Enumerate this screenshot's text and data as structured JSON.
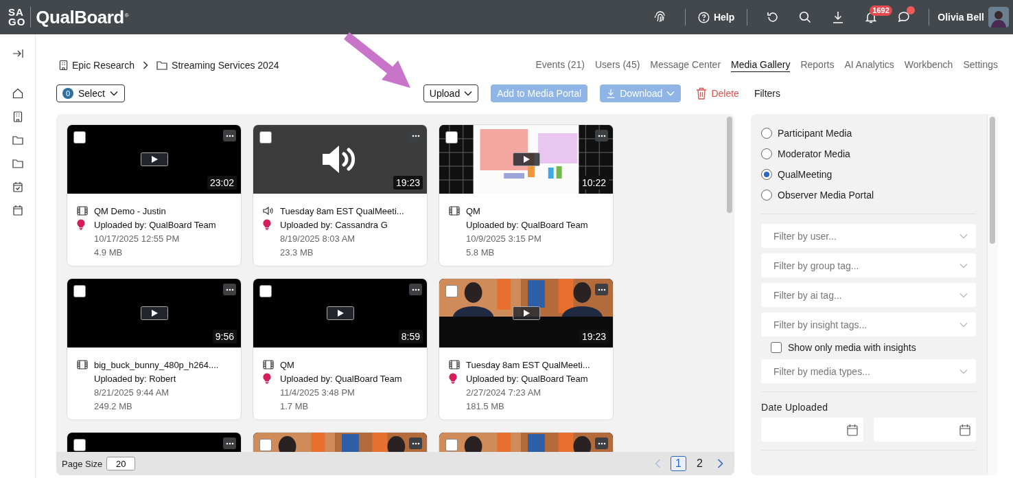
{
  "header": {
    "logo_mark": [
      "SA",
      "GO"
    ],
    "product": "QualBoard",
    "registered": "®",
    "help": "Help",
    "notifications": "1692",
    "user": "Olivia Bell"
  },
  "breadcrumb": [
    {
      "kind": "company",
      "label": "Epic Research"
    },
    {
      "kind": "folder",
      "label": "Streaming Services 2024"
    }
  ],
  "tabs": [
    {
      "label": "Events (21)",
      "selected": false
    },
    {
      "label": "Users (45)",
      "selected": false
    },
    {
      "label": "Message Center",
      "selected": false
    },
    {
      "label": "Media Gallery",
      "selected": true
    },
    {
      "label": "Reports",
      "selected": false
    },
    {
      "label": "AI Analytics",
      "selected": false
    },
    {
      "label": "Workbench",
      "selected": false
    },
    {
      "label": "Settings",
      "selected": false
    }
  ],
  "toolbar": {
    "select_count": "0",
    "select": "Select",
    "upload": "Upload",
    "add_to_portal": {
      "label": "Add to Media Portal",
      "disabled": true
    },
    "download": {
      "label": "Download",
      "disabled": true
    },
    "delete": "Delete",
    "filters": "Filters"
  },
  "cards": [
    {
      "thumbnail": {
        "kind": "video"
      },
      "selected": false,
      "duration": "23:02",
      "media_icon": {
        "kind": "film"
      },
      "title": "QM Demo - Justin",
      "uploaded_by": "Uploaded by: QualBoard Team",
      "insight": true,
      "date": "10/17/2025 12:55 PM",
      "size": "4.9 MB"
    },
    {
      "thumbnail": {
        "kind": "audio"
      },
      "selected": false,
      "duration": "19:23",
      "media_icon": {
        "kind": "speaker"
      },
      "title": "Tuesday 8am EST QualMeeti...",
      "uploaded_by": "Uploaded by: Cassandra G",
      "insight": true,
      "date": "8/19/2025 8:03 AM",
      "size": "23.3 MB"
    },
    {
      "selected": false,
      "duration": "10:22",
      "media_icon": {
        "kind": "film"
      },
      "title": "QM",
      "uploaded_by": "Uploaded by: QualBoard Team",
      "insight": false,
      "date": "10/9/2025 3:15 PM",
      "size": "5.8 MB"
    },
    {
      "thumbnail": {
        "kind": "video"
      },
      "selected": false,
      "duration": "9:56",
      "media_icon": {
        "kind": "film"
      },
      "title": "big_buck_bunny_480p_h264....",
      "uploaded_by": "Uploaded by: Robert",
      "insight": false,
      "date": "8/21/2025 9:44 AM",
      "size": "249.2 MB"
    },
    {
      "thumbnail": {
        "kind": "video"
      },
      "selected": false,
      "duration": "8:59",
      "media_icon": {
        "kind": "film"
      },
      "title": "QM",
      "uploaded_by": "Uploaded by: QualBoard Team",
      "insight": true,
      "date": "11/4/2025 3:48 PM",
      "size": "1.7 MB"
    },
    {
      "selected": false,
      "duration": "19:23",
      "media_icon": {
        "kind": "film"
      },
      "title": "Tuesday 8am EST QualMeeti...",
      "uploaded_by": "Uploaded by: QualBoard Team",
      "insight": true,
      "date": "2/27/2024 7:23 AM",
      "size": "181.5 MB"
    },
    {
      "thumbnail": {
        "kind": "video"
      },
      "selected": false
    },
    {
      "selected": false
    },
    {
      "selected": false
    }
  ],
  "pagination": {
    "page_size_label": "Page Size",
    "page_size": "20",
    "pages": [
      {
        "label": "1",
        "selected": true
      },
      {
        "label": "2",
        "selected": false
      }
    ]
  },
  "filters": {
    "media_sources": [
      {
        "label": "Participant Media",
        "selected": false
      },
      {
        "label": "Moderator Media",
        "selected": false
      },
      {
        "label": "QualMeeting",
        "selected": true
      },
      {
        "label": "Observer Media Portal",
        "selected": false
      }
    ],
    "items": [
      {
        "kind": "select",
        "placeholder": "Filter by user..."
      },
      {
        "kind": "select",
        "placeholder": "Filter by group tag..."
      },
      {
        "kind": "select",
        "placeholder": "Filter by ai tag..."
      },
      {
        "kind": "select",
        "placeholder": "Filter by insight tags..."
      },
      {
        "kind": "checkbox",
        "label": "Show only media with insights",
        "checked": false
      },
      {
        "kind": "select",
        "placeholder": "Filter by media types..."
      }
    ],
    "date_label": "Date Uploaded"
  }
}
